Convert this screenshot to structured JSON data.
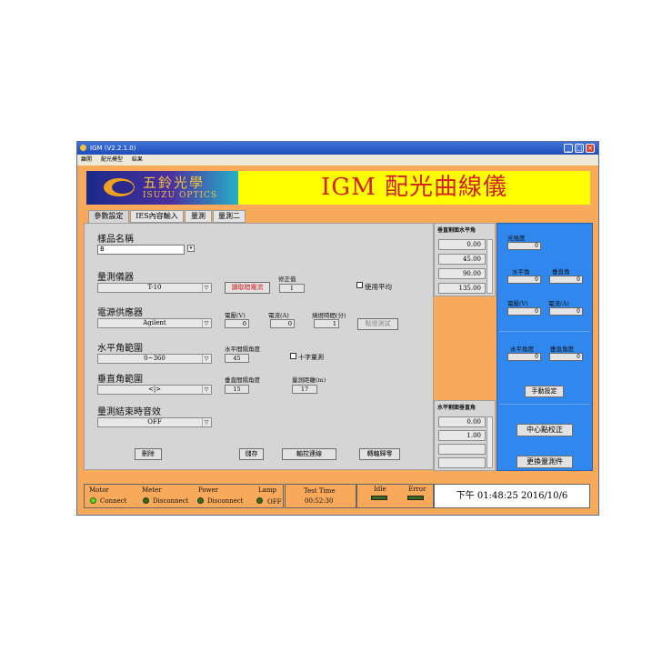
{
  "window": {
    "title": "IGM (V2.2.1.0)"
  },
  "menu": [
    "離開",
    "配光模型",
    "結果"
  ],
  "logo": {
    "chinese": "五鈴光學",
    "english": "ISUZU OPTICS"
  },
  "app_title": "IGM 配光曲線儀",
  "tabs": [
    "參數設定",
    "IES內容輸入",
    "量測",
    "量測二"
  ],
  "sample": {
    "label": "樣品名稱",
    "value": "B",
    "spin": "▾"
  },
  "instrument": {
    "label": "量測儀器",
    "value": "T-10",
    "read_button": "讀取暗電流",
    "correction_label": "修正值",
    "correction_value": "1",
    "average_label": "使用平均"
  },
  "power": {
    "label": "電源供應器",
    "value": "Agilent",
    "voltage_label": "電壓(V)",
    "voltage_value": "0",
    "current_label": "電流(A)",
    "current_value": "0",
    "warmup_label": "燒燈時間(分)",
    "warmup_value": "1",
    "test_button": "點燈測試"
  },
  "horizontal": {
    "label": "水平角範圍",
    "value": "0~360",
    "interval_label": "水平間隔角度",
    "interval_value": "45",
    "cross_label": "十字量測"
  },
  "vertical": {
    "label": "垂直角範圍",
    "value": "<|>",
    "interval_label": "垂直間隔角度",
    "interval_value": "15",
    "distance_label": "量測距離(m)",
    "distance_value": "17"
  },
  "end_sound": {
    "label": "量測結束時音效",
    "value": "OFF"
  },
  "buttons": {
    "delete": "刪除",
    "save": "儲存",
    "axis_connect": "軸控連線",
    "axis_zero": "轉軸歸零"
  },
  "vlist": {
    "title": "垂直割面水平角",
    "values": [
      "0.00",
      "45.00",
      "90.00",
      "135.00"
    ]
  },
  "hlist": {
    "title": "水平割面垂直角",
    "values": [
      "0.00",
      "1.00",
      "",
      ""
    ]
  },
  "right": {
    "intensity_label": "光強度",
    "intensity_value": "0",
    "h_angle_label": "水平角",
    "h_angle_value": "0",
    "v_angle_label": "垂直角",
    "v_angle_value": "0",
    "voltage_label": "電壓(V)",
    "voltage_value": "0",
    "current_label": "電流(A)",
    "current_value": "0",
    "h_deg_label": "水平角度",
    "h_deg_value": "0",
    "v_deg_label": "垂直角度",
    "v_deg_value": "0",
    "manual_button": "手動設定",
    "center_button": "中心點校正",
    "change_button": "更換量測件"
  },
  "status": {
    "motor_label": "Motor",
    "motor_state": "Connect",
    "meter_label": "Meter",
    "meter_state": "Disconnect",
    "power_label": "Power",
    "power_state": "Disconnect",
    "lamp_label": "Lamp",
    "lamp_state": "OFF",
    "test_time_label": "Test Time",
    "test_time_value": "00:52:30",
    "idle_label": "Idle",
    "error_label": "Error"
  },
  "clock": "下午 01:48:25 2016/10/6",
  "colors": {
    "window_bg": "#f9a95a",
    "title_yellow": "#ffff00",
    "title_red": "#d12020",
    "blue_panel": "#3088ee",
    "led_green": "#5fd82a",
    "led_off": "#3a6a20"
  }
}
